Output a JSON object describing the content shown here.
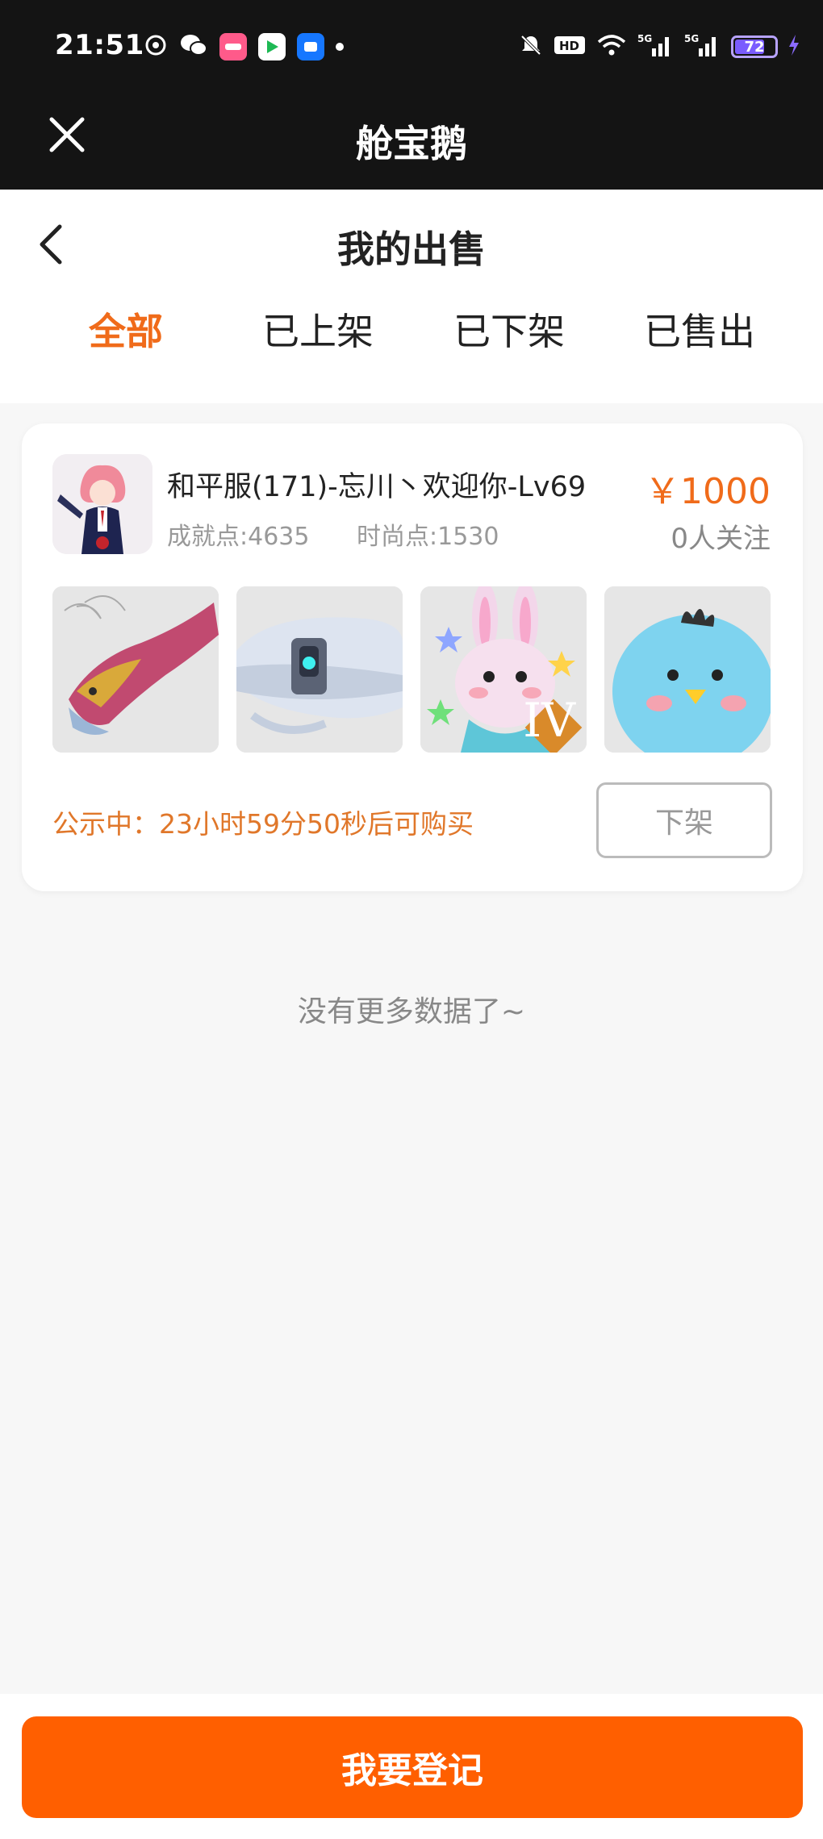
{
  "status_bar": {
    "time": "21:51",
    "battery": "72",
    "network": [
      "5G",
      "5G"
    ],
    "app_icons": [
      "netease-icon",
      "wechat-icon",
      "lofter-icon",
      "youku-icon",
      "xianyu-icon"
    ]
  },
  "app": {
    "title": "舱宝鹅"
  },
  "page": {
    "title": "我的出售",
    "tabs": [
      {
        "label": "全部",
        "active": true
      },
      {
        "label": "已上架",
        "active": false
      },
      {
        "label": "已下架",
        "active": false
      },
      {
        "label": "已售出",
        "active": false
      }
    ]
  },
  "listing": {
    "title": "和平服(171)-忘川丶欢迎你-Lv69",
    "achievement": "成就点:4635",
    "fashion": "时尚点:1530",
    "price": "￥1000",
    "followers": "0人关注",
    "thumbnails": [
      "dragon-mount-thumb",
      "spaceship-thumb",
      "bunny-pet-thumb",
      "bird-pet-thumb"
    ],
    "thumb_badge": "IV",
    "notice": "公示中：23小时59分50秒后可购买",
    "delist_label": "下架"
  },
  "footer_note": "没有更多数据了~",
  "actions": {
    "register_label": "我要登记"
  },
  "colors": {
    "accent": "#f06b1a",
    "button": "#ff5f00",
    "header_bg": "#141414"
  }
}
